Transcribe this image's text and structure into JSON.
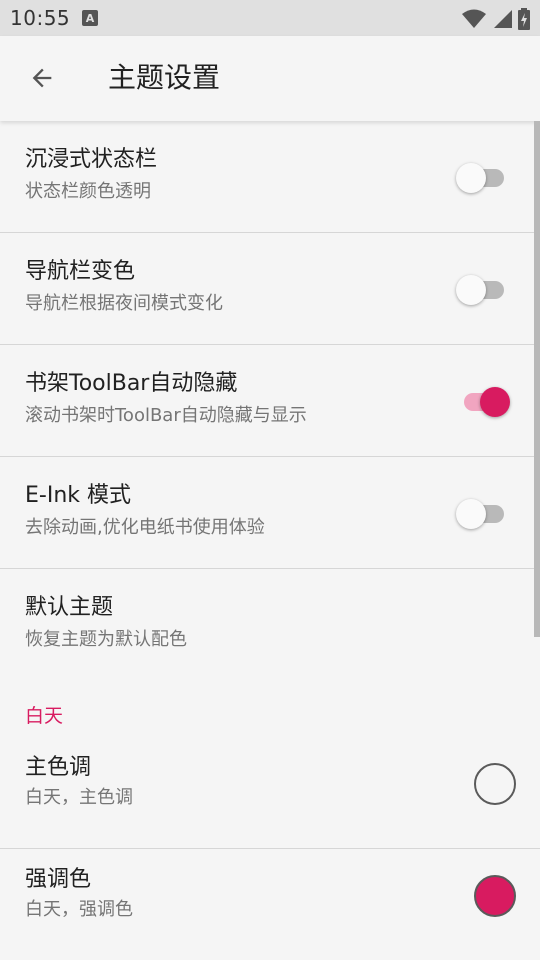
{
  "status_bar": {
    "time": "10:55",
    "notification_icon_letter": "A",
    "icons": [
      "wifi-icon",
      "signal-icon",
      "battery-charging-icon"
    ]
  },
  "app_bar": {
    "back_icon": "arrow-back-icon",
    "title": "主题设置"
  },
  "settings": [
    {
      "title": "沉浸式状态栏",
      "subtitle": "状态栏颜色透明",
      "enabled": false
    },
    {
      "title": "导航栏变色",
      "subtitle": "导航栏根据夜间模式变化",
      "enabled": false
    },
    {
      "title": "书架ToolBar自动隐藏",
      "subtitle": "滚动书架时ToolBar自动隐藏与显示",
      "enabled": true
    },
    {
      "title": "E-Ink 模式",
      "subtitle": "去除动画,优化电纸书使用体验",
      "enabled": false
    }
  ],
  "default_theme": {
    "title": "默认主题",
    "subtitle": "恢复主题为默认配色"
  },
  "day_section": {
    "label": "白天",
    "items": [
      {
        "title": "主色调",
        "subtitle": "白天，主色调",
        "color": "#f5f5f5"
      },
      {
        "title": "强调色",
        "subtitle": "白天，强调色",
        "color": "#d81b60"
      }
    ]
  },
  "colors": {
    "accent": "#d81b60",
    "background": "#f5f5f5",
    "status_bar": "#e0e0e0"
  }
}
